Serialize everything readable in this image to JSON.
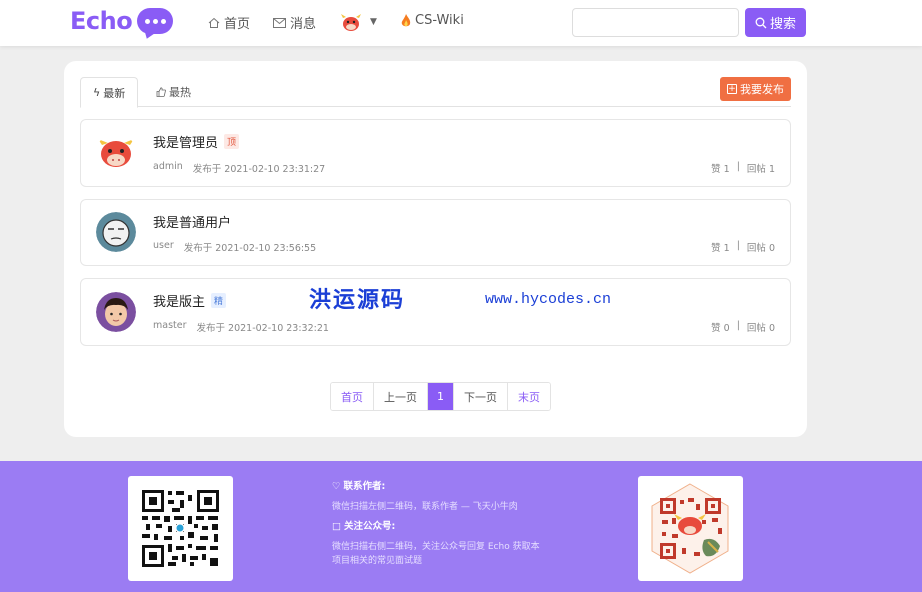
{
  "header": {
    "logo_text": "Echo",
    "nav": [
      {
        "icon": "home-icon",
        "label": "首页"
      },
      {
        "icon": "mail-icon",
        "label": "消息"
      },
      {
        "icon": "flame-icon",
        "label": "CS-Wiki"
      }
    ],
    "search": {
      "placeholder": "",
      "button_label": "搜索"
    }
  },
  "tabs": [
    {
      "label": "最新",
      "icon": "lightning-icon",
      "active": true
    },
    {
      "label": "最热",
      "icon": "thumb-up-icon",
      "active": false
    }
  ],
  "publish_label": "我要发布",
  "posts": [
    {
      "title": "我是管理员",
      "badge": "顶",
      "author": "admin",
      "date": "发布于 2021-02-10 23:31:27",
      "likes": "赞 1",
      "replies": "回帖 1"
    },
    {
      "title": "我是普通用户",
      "badge": "",
      "author": "user",
      "date": "发布于 2021-02-10 23:56:55",
      "likes": "赞 1",
      "replies": "回帖 0"
    },
    {
      "title": "我是版主",
      "badge": "精",
      "author": "master",
      "date": "发布于 2021-02-10 23:32:21",
      "likes": "赞 0",
      "replies": "回帖 0"
    }
  ],
  "watermark": {
    "text": "洪运源码",
    "url": "www.hycodes.cn"
  },
  "pagination": {
    "first": "首页",
    "prev": "上一页",
    "current": "1",
    "next": "下一页",
    "last": "末页"
  },
  "footer": {
    "contact_heading": "联系作者:",
    "contact_text": "微信扫描左侧二维码，联系作者 — 飞天小牛肉",
    "public_heading": "关注公众号:",
    "public_text_1": "微信扫描右侧二维码，关注公众号回复 Echo 获取本",
    "public_text_2": "项目相关的常见面试题"
  },
  "colors": {
    "brand": "#8a5cf5",
    "publish": "#f06f42",
    "footer": "#9b7cf3"
  }
}
